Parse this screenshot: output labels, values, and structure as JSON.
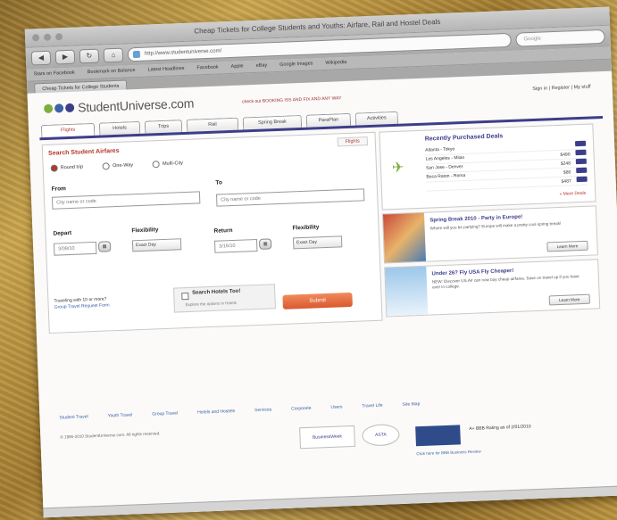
{
  "browser": {
    "window_title": "Cheap Tickets for College Students and Youths: Airfare, Rail and Hostel Deals",
    "url": "http://www.studentuniverse.com/",
    "search_placeholder": "Google",
    "bookmarks": [
      "Stars on Facebook",
      "Bookmark on Balance",
      "Latest Headlines",
      "Facebook",
      "Apple",
      "eBay",
      "Google Images",
      "Wikipedia"
    ],
    "tabs": [
      "Cheap Tickets for College Students"
    ]
  },
  "site": {
    "brand": "StudentUniverse.com",
    "logo_colors": [
      "#7cae3c",
      "#3d62a8",
      "#3d3e8a"
    ],
    "promo_line": "check out BOOKING ISS AND FIX AND ANY WAY",
    "sign_in": "Sign in | Register | My stuff",
    "nav": [
      "Flights",
      "Hotels",
      "Trips",
      "Rail",
      "Spring Break",
      "ParaPlan",
      "Activities"
    ],
    "accent": "#b2382e",
    "nav_color": "#3d3e8a"
  },
  "form": {
    "title": "Search Student Airfares",
    "tag": "Flights",
    "trip_types": [
      "Round trip",
      "One-Way",
      "Multi-City"
    ],
    "from_label": "From",
    "from_placeholder": "City name or code",
    "to_label": "To",
    "to_placeholder": "City name or code",
    "depart_label": "Depart",
    "depart_value": "3/09/10",
    "flex1_label": "Flexibility",
    "flex1_value": "Exact Day",
    "return_label": "Return",
    "return_value": "3/16/10",
    "flex2_label": "Flexibility",
    "flex2_value": "Exact Day",
    "hotels_title": "Search Hotels Too!",
    "hotels_sub": "Explore the options in Hotels",
    "help_title": "Traveling with 10 or more?",
    "help_link": "Group Travel Request Form",
    "submit": "Submit"
  },
  "deals": {
    "title": "Recently Purchased Deals",
    "rows": [
      {
        "route": "Atlanta - Tokyo",
        "price": ""
      },
      {
        "route": "Los Angeles - Milan",
        "price": "$490"
      },
      {
        "route": "San Jose - Denver",
        "price": "$248"
      },
      {
        "route": "Boca Raton - Roma",
        "price": "$80"
      },
      {
        "route": "",
        "price": "$487"
      }
    ],
    "more": "» More Deals"
  },
  "promos": [
    {
      "title": "Spring Break 2010 - Party in Europe!",
      "desc": "Where will you be partying? Europe will make a pretty cool spring break!",
      "button": "Learn More"
    },
    {
      "title": "Under 26? Fly USA Fly Cheaper!",
      "desc": "NEW: Discover US.Air can now buy cheap airfares. Save on travel up if you have ever in college.",
      "button": "Learn More"
    }
  ],
  "footer": {
    "links": [
      "Student Travel",
      "Youth Travel",
      "Group Travel",
      "Hotels and Hostels",
      "Services",
      "Corporate",
      "Users",
      "Travel Life",
      "Site Map"
    ],
    "copyright": "© 1995-2010 StudentUniverse.com. All rights reserved.",
    "badges": [
      "BusinessWeek",
      "ASTA"
    ],
    "bbb_text": "A+ BBB Rating as of 2/01/2010",
    "bbb_link": "Click here for BBB Business Review"
  }
}
